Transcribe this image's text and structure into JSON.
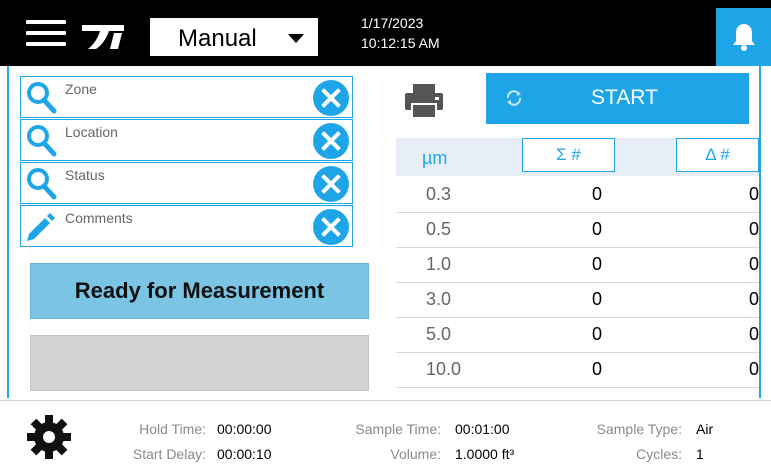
{
  "header": {
    "menu_icon": "hamburger-menu-icon",
    "logo_icon": "tsi-logo-icon",
    "mode": "Manual",
    "date": "1/17/2023",
    "time": "10:12:15 AM",
    "bell_icon": "bell-icon",
    "accent_color": "#1ea5e8"
  },
  "fields": [
    {
      "icon": "search-icon",
      "placeholder": "Zone",
      "value": ""
    },
    {
      "icon": "search-icon",
      "placeholder": "Location",
      "value": ""
    },
    {
      "icon": "search-icon",
      "placeholder": "Status",
      "value": ""
    },
    {
      "icon": "pencil-icon",
      "placeholder": "Comments",
      "value": ""
    }
  ],
  "status_button": "Ready for Measurement",
  "toolbar": {
    "printer_icon": "printer-icon",
    "start_label": "START",
    "refresh_icon": "refresh-icon"
  },
  "table": {
    "unit": "µm",
    "sum_header": "Σ #",
    "delta_header": "Δ #",
    "rows": [
      {
        "size": "0.3",
        "sum": "0",
        "delta": "0"
      },
      {
        "size": "0.5",
        "sum": "0",
        "delta": "0"
      },
      {
        "size": "1.0",
        "sum": "0",
        "delta": "0"
      },
      {
        "size": "3.0",
        "sum": "0",
        "delta": "0"
      },
      {
        "size": "5.0",
        "sum": "0",
        "delta": "0"
      },
      {
        "size": "10.0",
        "sum": "0",
        "delta": "0"
      }
    ]
  },
  "footer": {
    "settings_icon": "gear-icon",
    "hold_time_label": "Hold Time:",
    "hold_time": "00:00:00",
    "start_delay_label": "Start Delay:",
    "start_delay": "00:00:10",
    "sample_time_label": "Sample Time:",
    "sample_time": "00:01:00",
    "volume_label": "Volume:",
    "volume": "1.0000 ft³",
    "sample_type_label": "Sample Type:",
    "sample_type": "Air",
    "cycles_label": "Cycles:",
    "cycles": "1"
  }
}
